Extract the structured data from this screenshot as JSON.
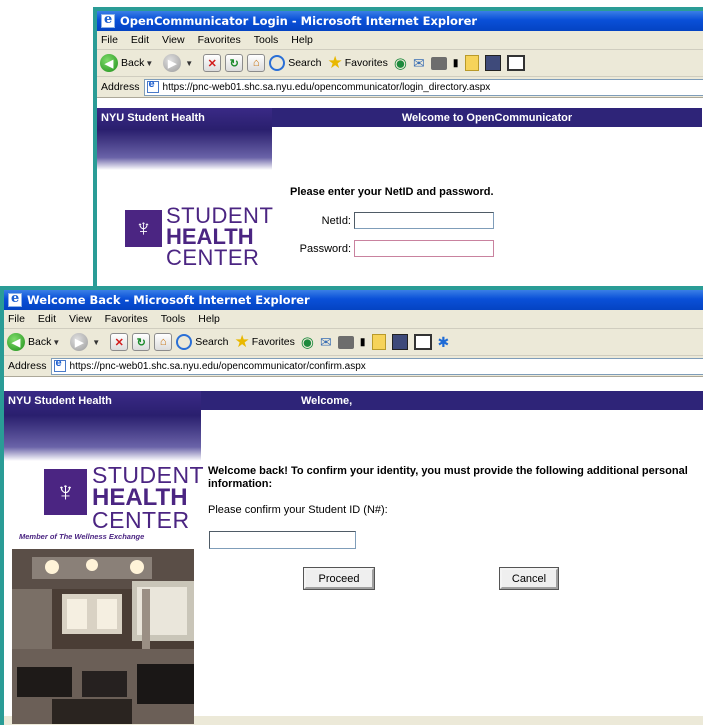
{
  "window1": {
    "title": "OpenCommunicator Login - Microsoft Internet Explorer",
    "menu": [
      "File",
      "Edit",
      "View",
      "Favorites",
      "Tools",
      "Help"
    ],
    "toolbar": {
      "back": "Back",
      "search": "Search",
      "favorites": "Favorites"
    },
    "address_label": "Address",
    "url": "https://pnc-web01.shc.sa.nyu.edu/opencommunicator/login_directory.aspx",
    "header_left": "NYU Student Health",
    "header_right": "Welcome to OpenCommunicator",
    "logo": {
      "line1": "STUDENT",
      "line2": "HEALTH",
      "line3": "CENTER"
    },
    "prompt": "Please enter your NetID and password.",
    "netid_label": "NetId:",
    "password_label": "Password:"
  },
  "window2": {
    "title": "Welcome Back - Microsoft Internet Explorer",
    "menu": [
      "File",
      "Edit",
      "View",
      "Favorites",
      "Tools",
      "Help"
    ],
    "toolbar": {
      "back": "Back",
      "search": "Search",
      "favorites": "Favorites"
    },
    "address_label": "Address",
    "url": "https://pnc-web01.shc.sa.nyu.edu/opencommunicator/confirm.aspx",
    "header_left": "NYU Student Health",
    "header_right": "Welcome,",
    "logo": {
      "line1": "STUDENT",
      "line2": "HEALTH",
      "line3": "CENTER",
      "tagline": "Member of The Wellness Exchange"
    },
    "message": "Welcome back! To confirm your identity, you must provide the following additional personal information:",
    "student_id_label": "Please confirm your Student ID (N#):",
    "student_id_value": "",
    "proceed_label": "Proceed",
    "cancel_label": "Cancel"
  },
  "colors": {
    "frame": "#2a9c96",
    "title_bar": "#0a50d8",
    "header_purple": "#2e2478",
    "logo_purple": "#4b2582"
  }
}
